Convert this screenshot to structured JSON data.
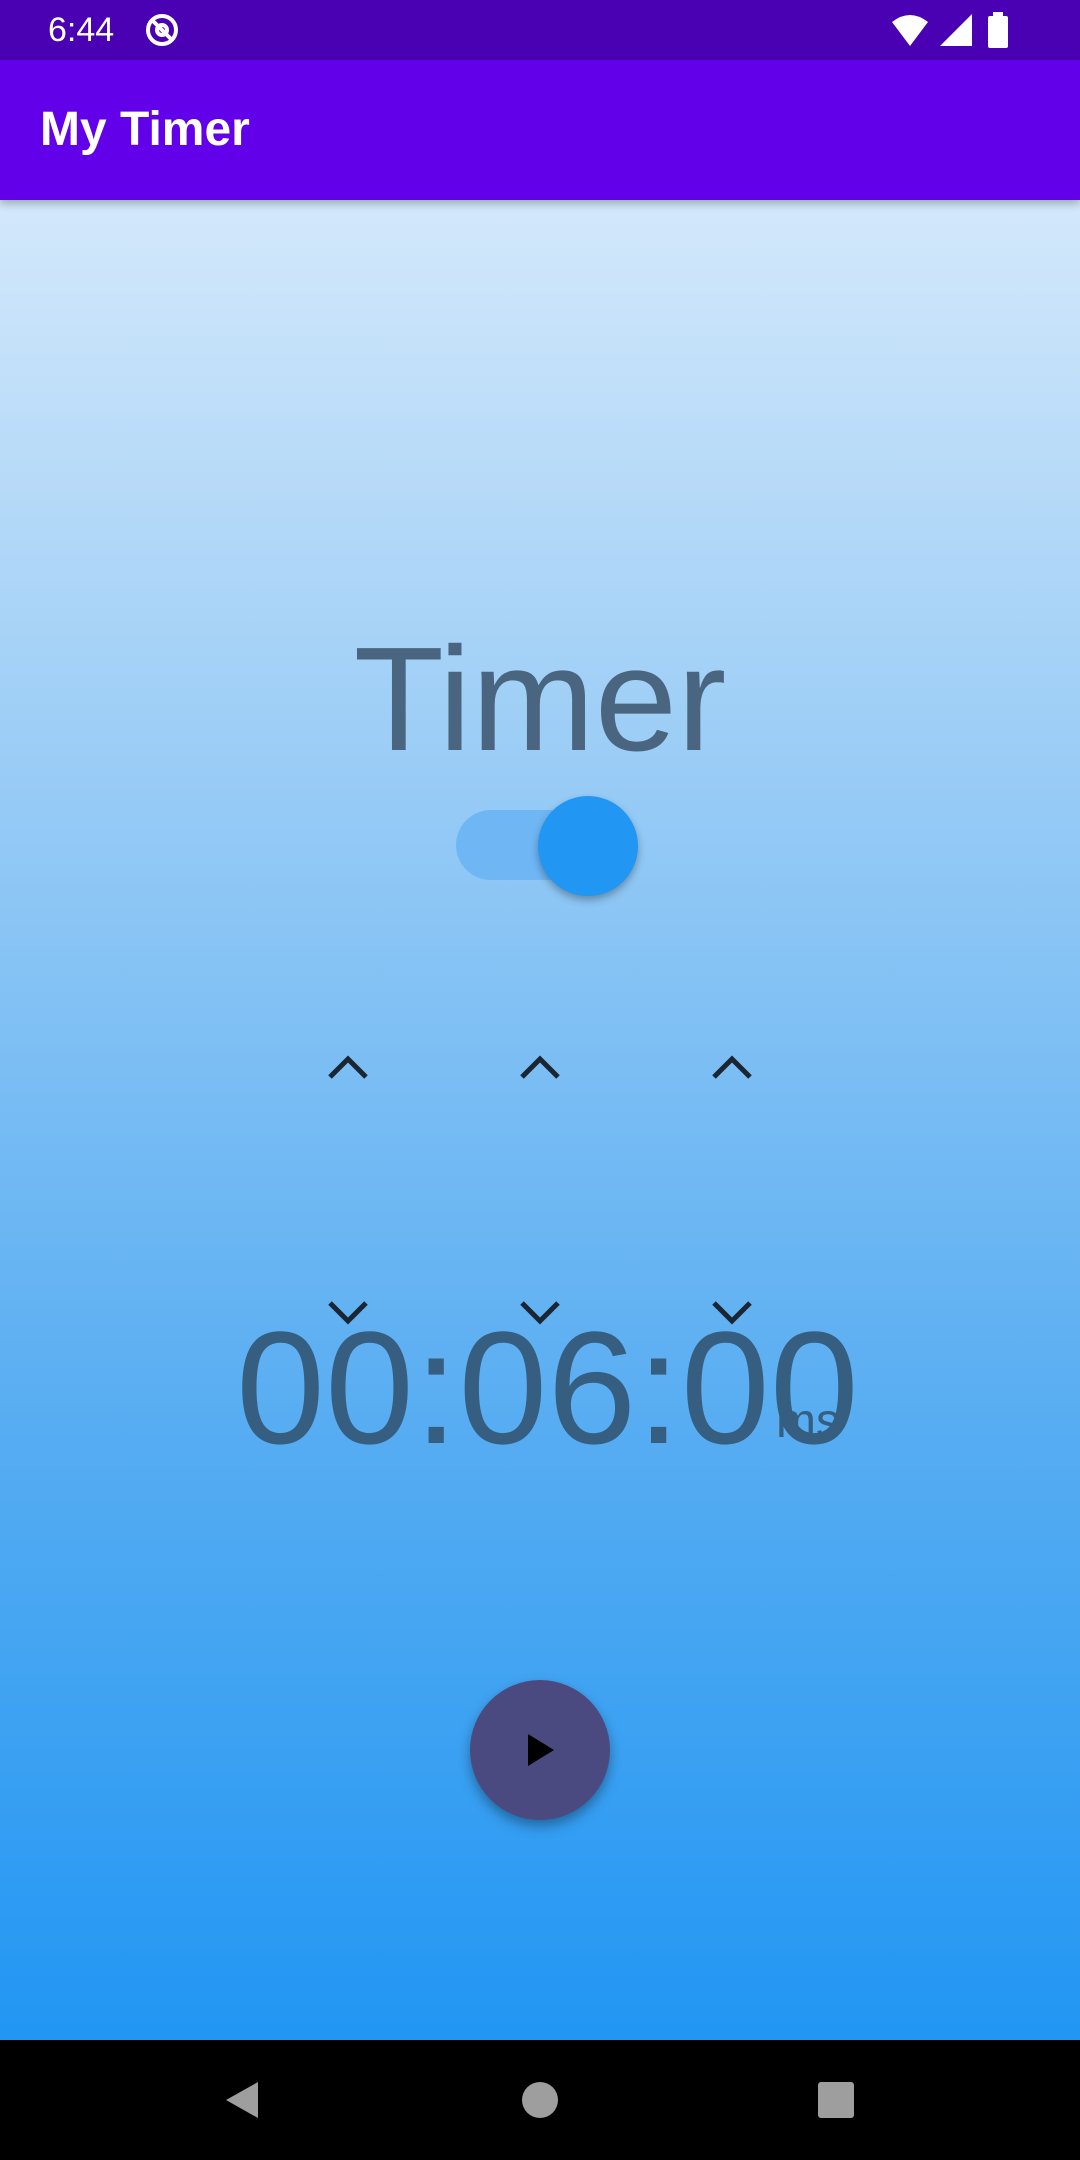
{
  "status_bar": {
    "time": "6:44",
    "icons": [
      "at-sign-icon",
      "wifi-icon",
      "signal-icon",
      "battery-icon"
    ],
    "background": "#4a00b3"
  },
  "app_bar": {
    "title": "My Timer",
    "background": "#6200ea"
  },
  "main": {
    "heading": "Timer",
    "toggle": {
      "state": "on",
      "accent": "#2196f3"
    },
    "time": {
      "display": "00:06:00",
      "unit": "ms",
      "segments": [
        "00",
        "06",
        "00"
      ]
    },
    "controls": {
      "increment_icon": "chevron-up-icon",
      "decrement_icon": "chevron-down-icon",
      "play_icon": "play-icon",
      "play_button_color": "#4a4a80"
    },
    "gradient": [
      "#d3e8fb",
      "#2196f3"
    ]
  },
  "nav_bar": {
    "buttons": [
      "back-icon",
      "home-icon",
      "recents-icon"
    ]
  }
}
